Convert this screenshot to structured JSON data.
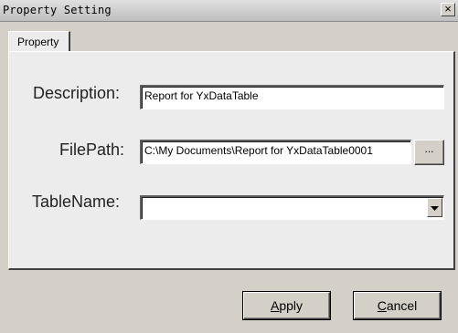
{
  "window": {
    "title": "Property Setting",
    "close_glyph": "×"
  },
  "tabs": [
    {
      "label": "Property",
      "selected": true
    }
  ],
  "form": {
    "description": {
      "label": "Description:",
      "value": "Report for YxDataTable"
    },
    "filepath": {
      "label": "FilePath:",
      "value": "C:\\My Documents\\Report for YxDataTable0001",
      "browse_label": "..."
    },
    "tablename": {
      "label": "TableName:",
      "value": ""
    }
  },
  "buttons": {
    "apply": {
      "mnemonic": "A",
      "rest": "pply"
    },
    "cancel": {
      "mnemonic": "C",
      "rest": "ancel"
    }
  },
  "icons": {
    "close": "close-icon",
    "dropdown": "chevron-down-icon"
  },
  "colors": {
    "dialog_bg": "#d4d0c8",
    "panel_bg": "#ececec",
    "field_bg": "#ffffff"
  }
}
